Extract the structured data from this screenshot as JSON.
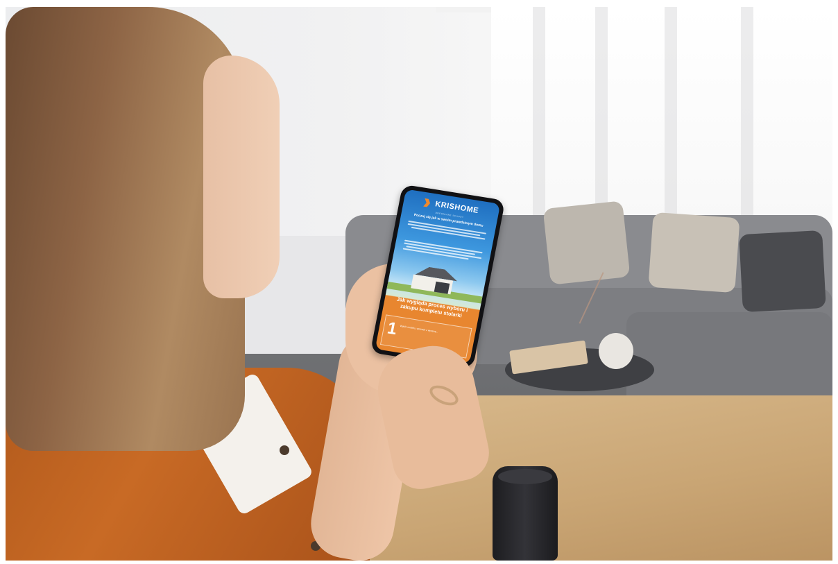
{
  "phone_screen": {
    "logo": {
      "name": "KRISHOME",
      "tagline": "DREWNIANE SCHODY"
    },
    "headline": "Poczuj się jak w swoim prawdziwym domu",
    "section_title": "Jak wygląda proces wyboru i zakupu kompletu stolarki",
    "step": {
      "number": "1",
      "text": "Wybór modelu, wniosek z wyceną..."
    }
  },
  "colors": {
    "brand_orange": "#e8862f",
    "brand_blue": "#1f6fc0",
    "shirt": "#c86a25",
    "table_wood": "#c9a574"
  }
}
